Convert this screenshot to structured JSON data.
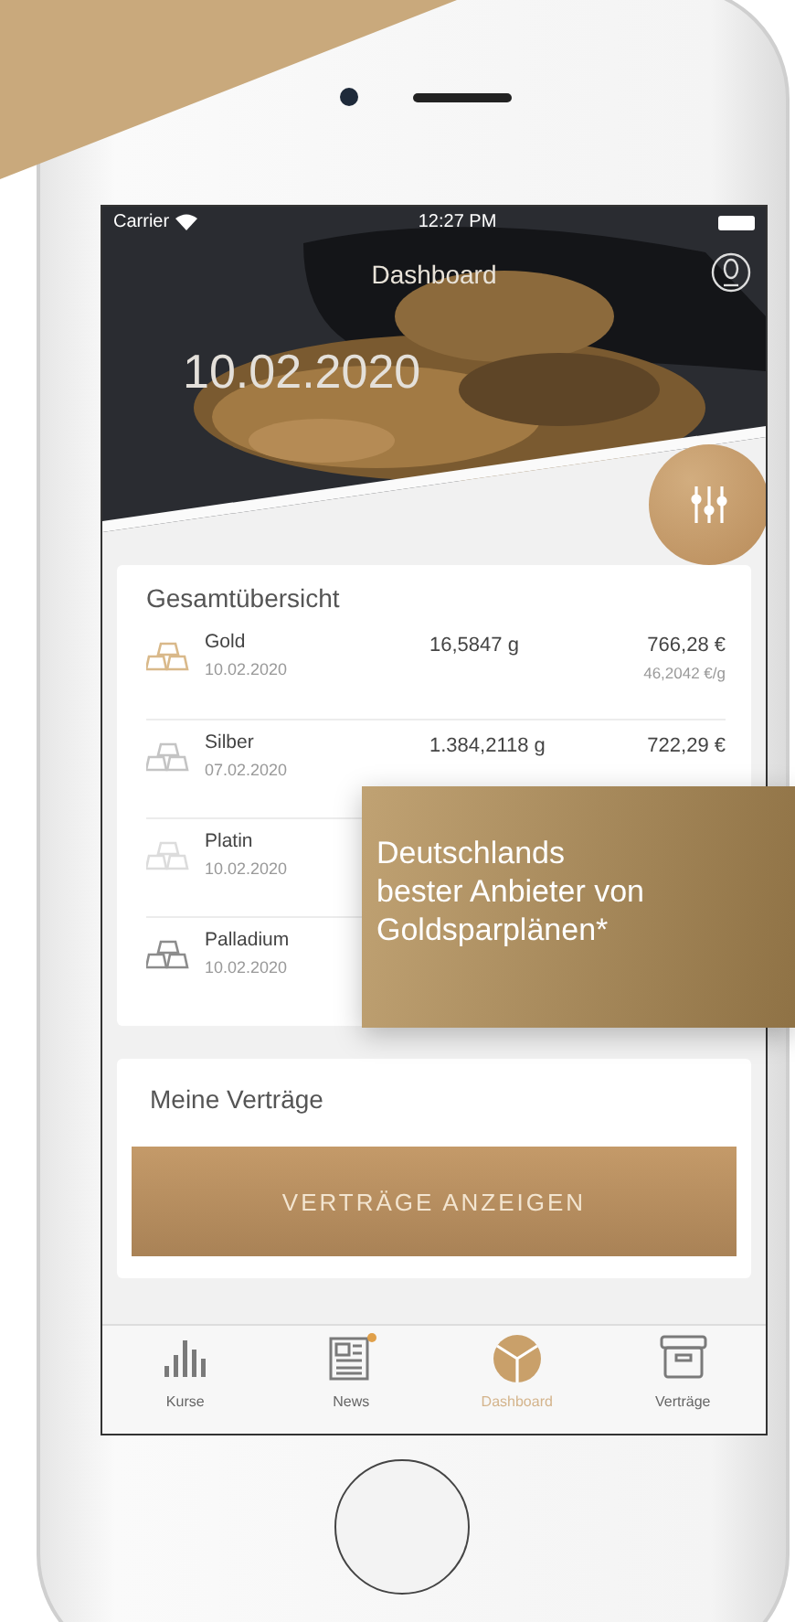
{
  "status_bar": {
    "carrier": "Carrier",
    "time": "12:27 PM"
  },
  "header": {
    "title": "Dashboard",
    "date": "10.02.2020"
  },
  "overview": {
    "title": "Gesamtübersicht",
    "metals": [
      {
        "name": "Gold",
        "date": "10.02.2020",
        "weight": "16,5847 g",
        "value": "766,28 €",
        "price": "46,2042 €/g",
        "color": "#d9b98a"
      },
      {
        "name": "Silber",
        "date": "07.02.2020",
        "weight": "1.384,2118 g",
        "value": "722,29 €",
        "color": "#c4c4c4"
      },
      {
        "name": "Platin",
        "date": "10.02.2020",
        "color": "#dcdcdc"
      },
      {
        "name": "Palladium",
        "date": "10.02.2020",
        "color": "#8c8c8c"
      }
    ]
  },
  "contracts": {
    "title": "Meine Verträge",
    "button": "VERTRÄGE ANZEIGEN"
  },
  "tabs": [
    {
      "label": "Kurse",
      "kind": "chart",
      "badge": false,
      "selected": false
    },
    {
      "label": "News",
      "kind": "news",
      "badge": true,
      "selected": false
    },
    {
      "label": "Dashboard",
      "kind": "dashboard",
      "badge": false,
      "selected": true
    },
    {
      "label": "Verträge",
      "kind": "box",
      "badge": false,
      "selected": false
    }
  ],
  "promo": {
    "lines": [
      "Deutschlands",
      "bester Anbieter von",
      "Goldsparplänen*"
    ]
  }
}
